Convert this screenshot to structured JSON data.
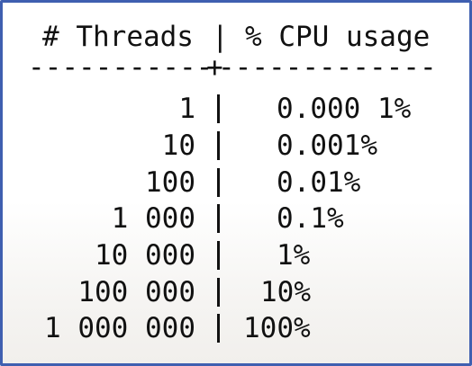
{
  "table": {
    "header_threads": "# Threads",
    "header_divider": "|",
    "header_cpu": "% CPU usage",
    "separator_left": "-----------",
    "separator_plus": "+",
    "separator_right": "-------------",
    "rows": [
      {
        "threads": "1",
        "cpu": "0.000 1%"
      },
      {
        "threads": "10",
        "cpu": "0.001%"
      },
      {
        "threads": "100",
        "cpu": "0.01%"
      },
      {
        "threads": "1 000",
        "cpu": "0.1%"
      },
      {
        "threads": "10 000",
        "cpu": "1%"
      },
      {
        "threads": "100 000",
        "cpu": "10%"
      },
      {
        "threads": "1 000 000",
        "cpu": "100%"
      }
    ]
  }
}
